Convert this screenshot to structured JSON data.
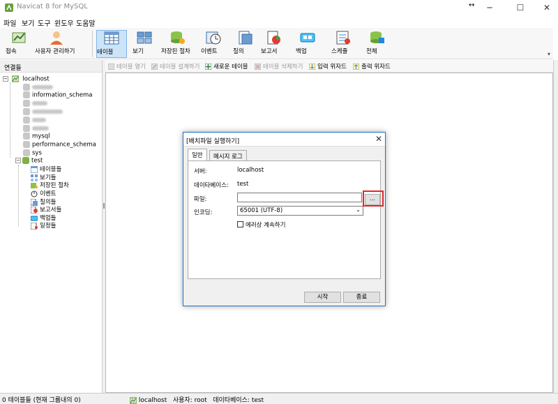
{
  "window": {
    "title": "Navicat 8 for MySQL",
    "minimize": "─",
    "maximize": "☐",
    "close": "✕",
    "resize_glyph": "↔"
  },
  "menu": [
    "파일",
    "보기",
    "도구",
    "윈도우",
    "도움말"
  ],
  "toolbar": {
    "buttons": [
      {
        "label": "접속",
        "icon": "connect-icon"
      },
      {
        "label": "사용자 관리하기",
        "icon": "user-manager-icon"
      },
      {
        "label": "테이블",
        "icon": "table-icon"
      },
      {
        "label": "보기",
        "icon": "view-icon"
      },
      {
        "label": "저장된 절차",
        "icon": "stored-procedure-icon"
      },
      {
        "label": "이벤트",
        "icon": "event-icon"
      },
      {
        "label": "질의",
        "icon": "query-icon"
      },
      {
        "label": "보고서",
        "icon": "report-icon"
      },
      {
        "label": "백업",
        "icon": "backup-icon"
      },
      {
        "label": "스케쥴",
        "icon": "schedule-icon"
      },
      {
        "label": "전체",
        "icon": "all-icon"
      }
    ]
  },
  "left_panel": {
    "header": "연결들",
    "connection": "localhost",
    "databases": [
      "information_schema",
      "mysql",
      "performance_schema",
      "sys",
      "test"
    ],
    "test_children": [
      "테이블들",
      "보기들",
      "저장된 절차",
      "이벤트",
      "질의들",
      "보고서들",
      "백업들",
      "일정들"
    ]
  },
  "object_toolbar": {
    "open_table": "테이블 열기",
    "design_table": "테이블 설계하기",
    "new_table": "새로운 테이블",
    "delete_table": "테이블 삭제하기",
    "import_wizard": "입력 위자드",
    "export_wizard": "출력 위자드"
  },
  "status": {
    "left": "0 테이블들 (현재 그룹내의 0)",
    "connection": "localhost",
    "user": "사용자: root",
    "database": "데이타베이스: test"
  },
  "dialog": {
    "title": "[배치파일 실행하기]",
    "tabs": [
      "일반",
      "메시지 로그"
    ],
    "server_label": "서버:",
    "server_value": "localhost",
    "database_label": "데이타베이스:",
    "database_value": "test",
    "file_label": "파일:",
    "file_value": "",
    "browse_label": "...",
    "encoding_label": "인코딩:",
    "encoding_value": "65001 (UTF-8)",
    "continue_on_error": "에러상 계속하기",
    "continue_checked": false,
    "start_button": "시작",
    "close_button": "종료"
  },
  "colors": {
    "accent": "#1a73c9",
    "highlight": "#e3262b",
    "active_tab": "#cce4f7"
  }
}
